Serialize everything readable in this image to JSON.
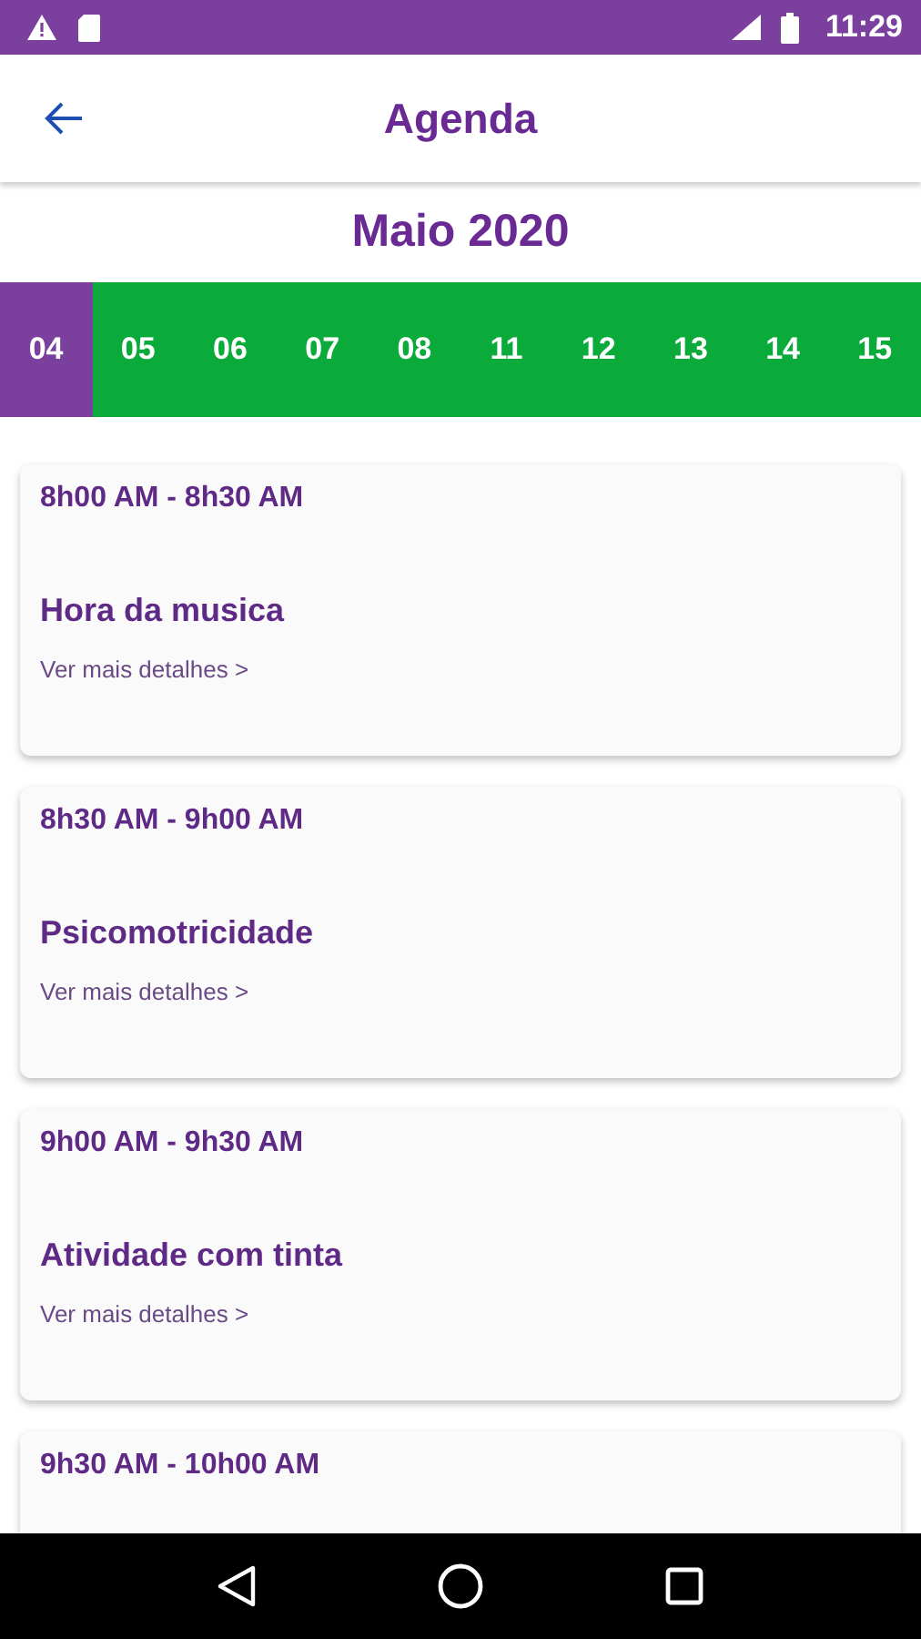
{
  "status_bar": {
    "time": "11:29"
  },
  "app_bar": {
    "title": "Agenda"
  },
  "month": "Maio 2020",
  "days": [
    {
      "label": "04",
      "selected": true
    },
    {
      "label": "05",
      "selected": false
    },
    {
      "label": "06",
      "selected": false
    },
    {
      "label": "07",
      "selected": false
    },
    {
      "label": "08",
      "selected": false
    },
    {
      "label": "11",
      "selected": false
    },
    {
      "label": "12",
      "selected": false
    },
    {
      "label": "13",
      "selected": false
    },
    {
      "label": "14",
      "selected": false
    },
    {
      "label": "15",
      "selected": false
    }
  ],
  "events": [
    {
      "time": "8h00 AM - 8h30 AM",
      "title": "Hora da musica",
      "link": "Ver mais detalhes >"
    },
    {
      "time": "8h30 AM - 9h00 AM",
      "title": "Psicomotricidade",
      "link": "Ver mais detalhes >"
    },
    {
      "time": "9h00 AM - 9h30 AM",
      "title": "Atividade com tinta",
      "link": "Ver mais detalhes >"
    },
    {
      "time": "9h30 AM - 10h00 AM"
    }
  ]
}
